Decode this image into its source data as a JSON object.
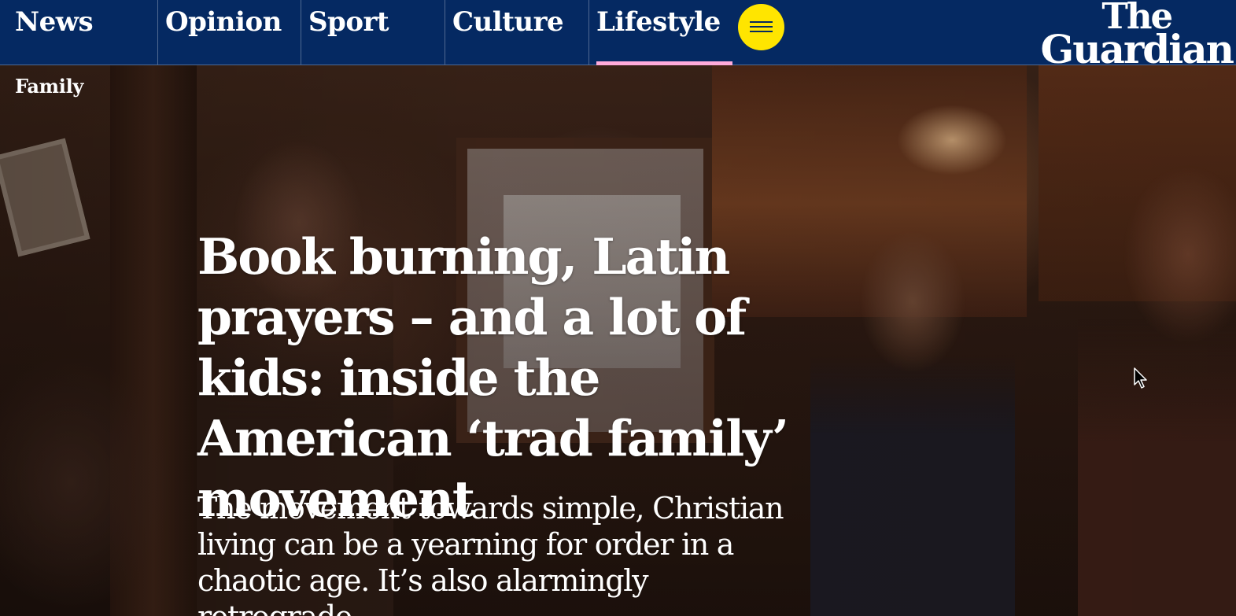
{
  "nav": {
    "items": [
      {
        "label": "News"
      },
      {
        "label": "Opinion"
      },
      {
        "label": "Sport"
      },
      {
        "label": "Culture"
      },
      {
        "label": "Lifestyle",
        "active": true
      }
    ],
    "menu_icon": "hamburger-menu-icon",
    "active_underline_color": "#ffabdb",
    "background_color": "#052962",
    "menu_button_color": "#ffe500"
  },
  "logo": {
    "line1": "The",
    "line2": "Guardian"
  },
  "article": {
    "kicker": "Family",
    "headline": "Book burning, Latin prayers – and a lot of kids: inside the American ‘trad family’ movement",
    "standfirst": "The movement towards simple, Christian living can be a yearning for order in a chaotic age. It’s also alarmingly retrograde"
  }
}
